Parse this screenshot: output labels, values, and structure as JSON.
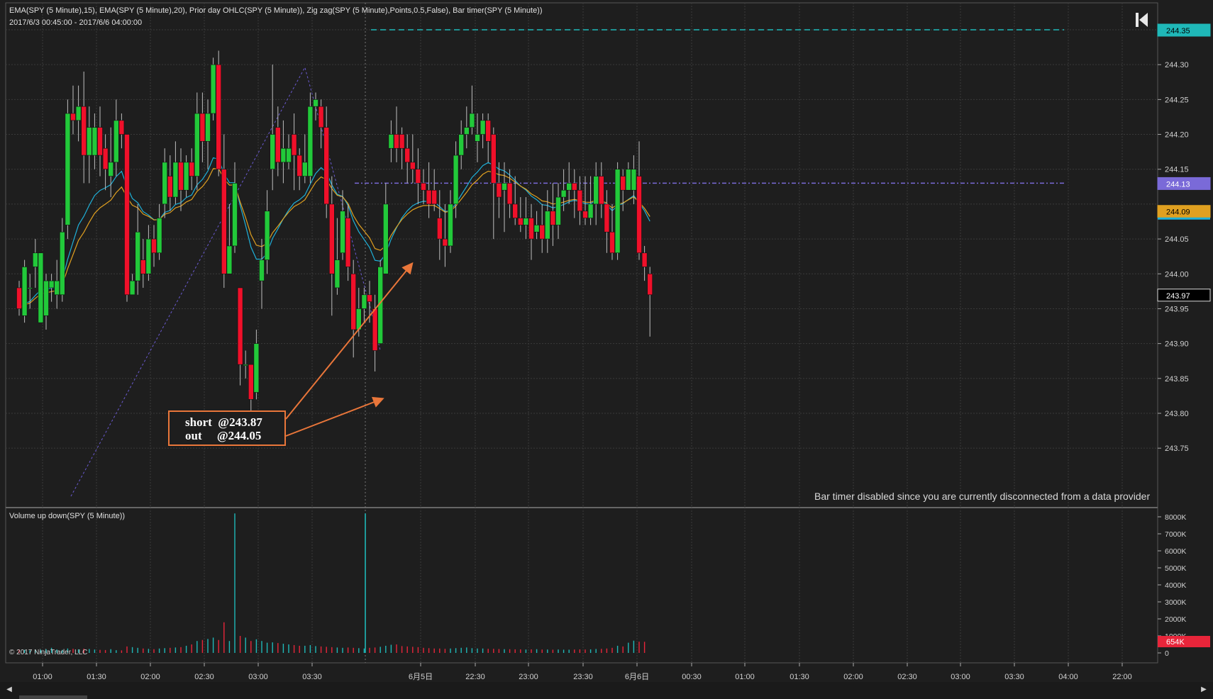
{
  "header": {
    "indicators": "EMA(SPY (5 Minute),15), EMA(SPY (5 Minute),20), Prior day OHLC(SPY (5 Minute)), Zig zag(SPY (5 Minute),Points,0.5,False), Bar timer(SPY (5 Minute))",
    "date_range": "2017/6/3 00:45:00 - 2017/6/6 04:00:00"
  },
  "price_axis": {
    "ticks": [
      "244.30",
      "244.25",
      "244.20",
      "244.15",
      "244.05",
      "244.00",
      "243.95",
      "243.90",
      "243.85",
      "243.80",
      "243.75"
    ]
  },
  "price_tags": [
    {
      "label": "244.35",
      "color": "#1fb8b8",
      "text_color": "#000000"
    },
    {
      "label": "244.13",
      "color": "#7a6ad8",
      "text_color": "#ffffff"
    },
    {
      "label": "244.09",
      "color": "#e0a020",
      "text_color": "#000000"
    },
    {
      "label": "243.97",
      "color": "#000000",
      "text_color": "#ffffff"
    }
  ],
  "volume_axis": {
    "ticks": [
      "8000K",
      "7000K",
      "6000K",
      "5000K",
      "4000K",
      "3000K",
      "2000K",
      "1000K",
      "0"
    ],
    "current_tag": {
      "label": "654K",
      "color": "#e8253a"
    }
  },
  "time_axis": {
    "labels": [
      "01:00",
      "01:30",
      "02:00",
      "02:30",
      "03:00",
      "03:30",
      "6月5日",
      "22:30",
      "23:00",
      "23:30",
      "6月6日",
      "00:30",
      "01:00",
      "01:30",
      "02:00",
      "02:30",
      "03:00",
      "03:30",
      "04:00",
      "22:00"
    ]
  },
  "annotation": {
    "text": "short  @243.87\nout     @244.05",
    "color": "#e9763a"
  },
  "status": {
    "bar_timer_message": "Bar timer disabled since you are currently disconnected from a data provider"
  },
  "volume_panel": {
    "title": "Volume up down(SPY (5 Minute))"
  },
  "footer": {
    "copyright": "© 2017 NinjaTrader, LLC"
  },
  "icons": {
    "nav_button": "skip-to-end-icon",
    "scroll_left": "scroll-left-arrow-icon",
    "scroll_right": "scroll-right-arrow-icon"
  },
  "colors": {
    "up": "#22c93a",
    "down": "#f0102a",
    "ema15": "#1fb0d8",
    "ema20": "#e0a020",
    "zigzag": "#6a5ad0",
    "prior_high": "#1fb8b8",
    "prior_close": "#7a6ad8",
    "vol_up": "#1fb8b8",
    "vol_down": "#e8253a",
    "background": "#1e1e1e",
    "grid": "#3a3a3a"
  },
  "chart_data": {
    "type": "candlestick",
    "instrument": "SPY (5 Minute)",
    "ylim": [
      243.73,
      244.38
    ],
    "reference_lines": {
      "prior_high": 244.35,
      "prior_close": 244.13
    },
    "candles": [
      [
        243.98,
        243.95,
        243.99,
        243.94
      ],
      [
        243.94,
        244.01,
        244.02,
        243.93
      ],
      [
        243.98,
        243.98,
        244.0,
        243.95
      ],
      [
        244.01,
        244.03,
        244.05,
        243.98
      ],
      [
        243.93,
        244.03,
        244.03,
        243.93
      ],
      [
        243.94,
        243.99,
        244.0,
        243.92
      ],
      [
        243.98,
        243.99,
        244.0,
        243.96
      ],
      [
        243.97,
        243.99,
        244.02,
        243.95
      ],
      [
        243.97,
        244.06,
        244.08,
        243.96
      ],
      [
        244.07,
        244.23,
        244.25,
        244.05
      ],
      [
        244.23,
        244.22,
        244.27,
        244.2
      ],
      [
        244.22,
        244.24,
        244.27,
        244.19
      ],
      [
        244.24,
        244.17,
        244.29,
        244.13
      ],
      [
        244.17,
        244.21,
        244.24,
        244.13
      ],
      [
        244.17,
        244.21,
        244.23,
        244.15
      ],
      [
        244.21,
        244.17,
        244.24,
        244.14
      ],
      [
        244.18,
        244.15,
        244.2,
        244.12
      ],
      [
        244.14,
        244.16,
        244.21,
        244.11
      ],
      [
        244.16,
        244.22,
        244.25,
        244.14
      ],
      [
        244.22,
        244.2,
        244.23,
        244.18
      ],
      [
        244.2,
        243.97,
        244.2,
        243.96
      ],
      [
        243.97,
        243.99,
        244.0,
        243.98
      ],
      [
        243.99,
        244.06,
        244.1,
        243.97
      ],
      [
        244.02,
        244.0,
        244.05,
        243.98
      ],
      [
        244.0,
        244.05,
        244.07,
        243.99
      ],
      [
        244.05,
        244.03,
        244.07,
        244.01
      ],
      [
        244.03,
        244.08,
        244.1,
        244.02
      ],
      [
        244.1,
        244.16,
        244.18,
        244.08
      ],
      [
        244.14,
        244.11,
        244.17,
        244.09
      ],
      [
        244.11,
        244.16,
        244.19,
        244.1
      ],
      [
        244.16,
        244.12,
        244.18,
        244.09
      ],
      [
        244.12,
        244.16,
        244.17,
        244.11
      ],
      [
        244.16,
        244.14,
        244.18,
        244.12
      ],
      [
        244.14,
        244.23,
        244.26,
        244.12
      ],
      [
        244.23,
        244.19,
        244.26,
        244.16
      ],
      [
        244.19,
        244.23,
        244.25,
        244.15
      ],
      [
        244.23,
        244.3,
        244.31,
        244.22
      ],
      [
        244.3,
        244.15,
        244.32,
        244.14
      ],
      [
        244.15,
        244.0,
        244.2,
        243.98
      ],
      [
        244.0,
        244.04,
        244.1,
        244.0
      ],
      [
        244.04,
        244.13,
        244.16,
        244.03
      ],
      [
        243.98,
        243.87,
        243.98,
        243.84
      ],
      [
        243.87,
        243.87,
        243.89,
        243.85
      ],
      [
        243.87,
        243.82,
        243.87,
        243.76
      ],
      [
        243.83,
        243.9,
        243.92,
        243.82
      ],
      [
        243.99,
        244.02,
        244.05,
        243.95
      ],
      [
        244.02,
        244.09,
        244.12,
        244.0
      ],
      [
        244.15,
        244.2,
        244.3,
        244.12
      ],
      [
        244.21,
        244.16,
        244.24,
        244.14
      ],
      [
        244.16,
        244.18,
        244.22,
        244.13
      ],
      [
        244.16,
        244.18,
        244.2,
        244.15
      ],
      [
        244.2,
        244.17,
        244.23,
        244.12
      ],
      [
        244.17,
        244.14,
        244.18,
        244.12
      ],
      [
        244.14,
        244.16,
        244.2,
        244.13
      ],
      [
        244.14,
        244.24,
        244.26,
        244.13
      ],
      [
        244.24,
        244.25,
        244.26,
        244.22
      ],
      [
        244.24,
        244.21,
        244.25,
        244.18
      ],
      [
        244.21,
        244.1,
        244.24,
        244.08
      ],
      [
        244.1,
        244.0,
        244.14,
        243.94
      ],
      [
        243.98,
        244.02,
        244.08,
        243.97
      ],
      [
        244.03,
        244.09,
        244.12,
        244.02
      ],
      [
        244.08,
        244.01,
        244.1,
        243.99
      ],
      [
        244.0,
        243.92,
        244.02,
        243.88
      ],
      [
        243.92,
        243.95,
        243.98,
        243.91
      ],
      [
        243.95,
        243.97,
        243.98,
        243.93
      ],
      [
        243.97,
        243.96,
        243.99,
        243.93
      ],
      [
        243.95,
        243.89,
        243.97,
        243.86
      ],
      [
        243.9,
        244.01,
        244.02,
        243.9
      ],
      [
        244.0,
        244.1,
        244.13,
        244.0
      ],
      [
        244.18,
        244.2,
        244.22,
        244.16
      ],
      [
        244.2,
        244.18,
        244.24,
        244.16
      ],
      [
        244.2,
        244.18,
        244.21,
        244.15
      ],
      [
        244.18,
        244.16,
        244.2,
        244.13
      ],
      [
        244.16,
        244.15,
        244.2,
        244.13
      ],
      [
        244.15,
        244.13,
        244.18,
        244.1
      ],
      [
        244.13,
        244.12,
        244.15,
        244.1
      ],
      [
        244.12,
        244.1,
        244.16,
        244.08
      ],
      [
        244.12,
        244.1,
        244.15,
        244.09
      ],
      [
        244.08,
        244.05,
        244.12,
        244.02
      ],
      [
        244.05,
        244.04,
        244.1,
        244.01
      ],
      [
        244.04,
        244.1,
        244.12,
        244.03
      ],
      [
        244.1,
        244.17,
        244.19,
        244.08
      ],
      [
        244.17,
        244.2,
        244.22,
        244.15
      ],
      [
        244.2,
        244.21,
        244.24,
        244.18
      ],
      [
        244.21,
        244.23,
        244.27,
        244.2
      ],
      [
        244.19,
        244.2,
        244.23,
        244.16
      ],
      [
        244.2,
        244.22,
        244.23,
        244.18
      ],
      [
        244.22,
        244.19,
        244.23,
        244.16
      ],
      [
        244.2,
        244.13,
        244.21,
        244.05
      ],
      [
        244.13,
        244.11,
        244.16,
        244.08
      ],
      [
        244.12,
        244.13,
        244.16,
        244.06
      ],
      [
        244.13,
        244.1,
        244.15,
        244.08
      ],
      [
        244.1,
        244.08,
        244.14,
        244.07
      ],
      [
        244.08,
        244.07,
        244.11,
        244.06
      ],
      [
        244.07,
        244.08,
        244.11,
        244.05
      ],
      [
        244.08,
        244.05,
        244.1,
        244.02
      ],
      [
        244.06,
        244.07,
        244.09,
        244.05
      ],
      [
        244.07,
        244.05,
        244.1,
        244.03
      ],
      [
        244.05,
        244.09,
        244.12,
        244.03
      ],
      [
        244.09,
        244.07,
        244.13,
        244.04
      ],
      [
        244.07,
        244.11,
        244.13,
        244.05
      ],
      [
        244.11,
        244.12,
        244.15,
        244.09
      ],
      [
        244.12,
        244.13,
        244.16,
        244.1
      ],
      [
        244.13,
        244.12,
        244.15,
        244.08
      ],
      [
        244.12,
        244.09,
        244.14,
        244.07
      ],
      [
        244.09,
        244.08,
        244.14,
        244.07
      ],
      [
        244.08,
        244.1,
        244.14,
        244.07
      ],
      [
        244.1,
        244.14,
        244.16,
        244.07
      ],
      [
        244.14,
        244.1,
        244.16,
        244.08
      ],
      [
        244.1,
        244.06,
        244.12,
        244.03
      ],
      [
        244.06,
        244.03,
        244.1,
        244.02
      ],
      [
        244.03,
        244.15,
        244.16,
        244.02
      ],
      [
        244.14,
        244.12,
        244.15,
        244.09
      ],
      [
        244.12,
        244.15,
        244.16,
        244.12
      ],
      [
        244.12,
        244.15,
        244.17,
        244.1
      ],
      [
        244.14,
        244.03,
        244.19,
        244.02
      ],
      [
        244.03,
        244.01,
        244.04,
        243.99
      ],
      [
        244.0,
        243.97,
        244.01,
        243.91
      ]
    ]
  }
}
